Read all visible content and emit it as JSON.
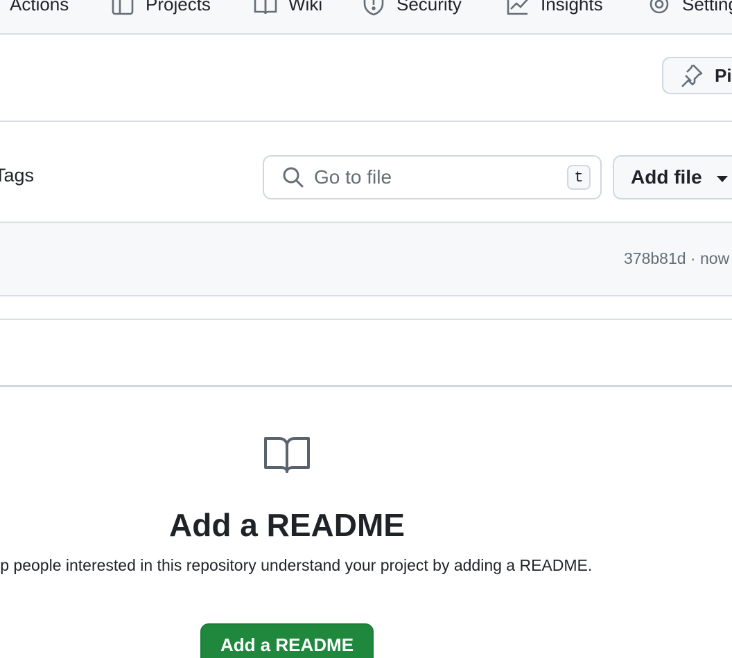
{
  "nav": {
    "items": [
      {
        "label": "Actions",
        "icon": "play-icon"
      },
      {
        "label": "Projects",
        "icon": "table-icon"
      },
      {
        "label": "Wiki",
        "icon": "book-icon"
      },
      {
        "label": "Security",
        "icon": "shield-icon"
      },
      {
        "label": "Insights",
        "icon": "graph-icon"
      },
      {
        "label": "Settings",
        "icon": "gear-icon"
      }
    ]
  },
  "pin": {
    "label": "Pin",
    "icon": "pin-icon"
  },
  "toolbar": {
    "tags_label": "Tags",
    "search_placeholder": "Go to file",
    "search_shortcut": "t",
    "add_file_label": "Add file"
  },
  "commit": {
    "meta": "378b81d · now"
  },
  "readme": {
    "title": "Add a README",
    "description": "Help people interested in this repository understand your project by adding a README.",
    "button_label": "Add a README"
  },
  "colors": {
    "accent_green": "#1f883d",
    "border": "#d0d7de",
    "muted_text": "#656d76"
  }
}
